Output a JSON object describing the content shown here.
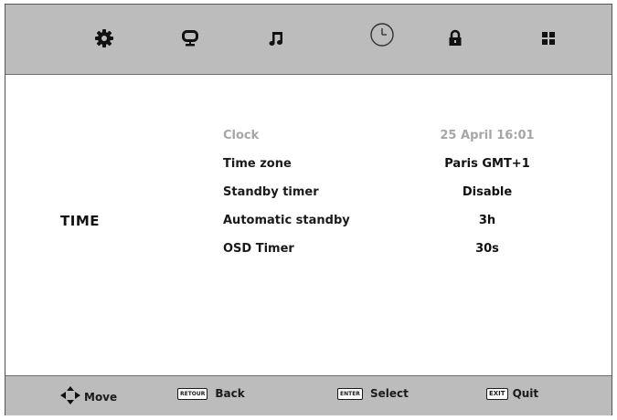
{
  "topbar": {
    "tabs": [
      {
        "icon": "gear-icon",
        "name": "Settings",
        "active": false
      },
      {
        "icon": "monitor-icon",
        "name": "Picture",
        "active": false
      },
      {
        "icon": "music-note-icon",
        "name": "Sound",
        "active": false
      },
      {
        "icon": "clock-icon",
        "name": "Time",
        "active": true
      },
      {
        "icon": "lock-icon",
        "name": "Lock",
        "active": false
      },
      {
        "icon": "grid-icon",
        "name": "Setup",
        "active": false
      }
    ]
  },
  "section": {
    "title": "TIME"
  },
  "menu": {
    "items": [
      {
        "label": "Clock",
        "value": "25 April 16:01",
        "enabled": false
      },
      {
        "label": "Time zone",
        "value": "Paris GMT+1",
        "enabled": true
      },
      {
        "label": "Standby timer",
        "value": "Disable",
        "enabled": true
      },
      {
        "label": "Automatic standby",
        "value": "3h",
        "enabled": true
      },
      {
        "label": "OSD Timer",
        "value": "30s",
        "enabled": true
      }
    ]
  },
  "footer": {
    "move": {
      "icon": "arrows-icon",
      "label": "Move"
    },
    "back": {
      "key": "RETOUR",
      "label": "Back"
    },
    "select": {
      "key": "ENTER",
      "label": "Select"
    },
    "quit": {
      "key": "EXIT",
      "label": "Quit"
    }
  },
  "colors": {
    "bar_background": "#bcbcbc",
    "content_background": "#ffffff",
    "disabled_text": "#a6a6a6",
    "text": "#1a1a1a"
  }
}
